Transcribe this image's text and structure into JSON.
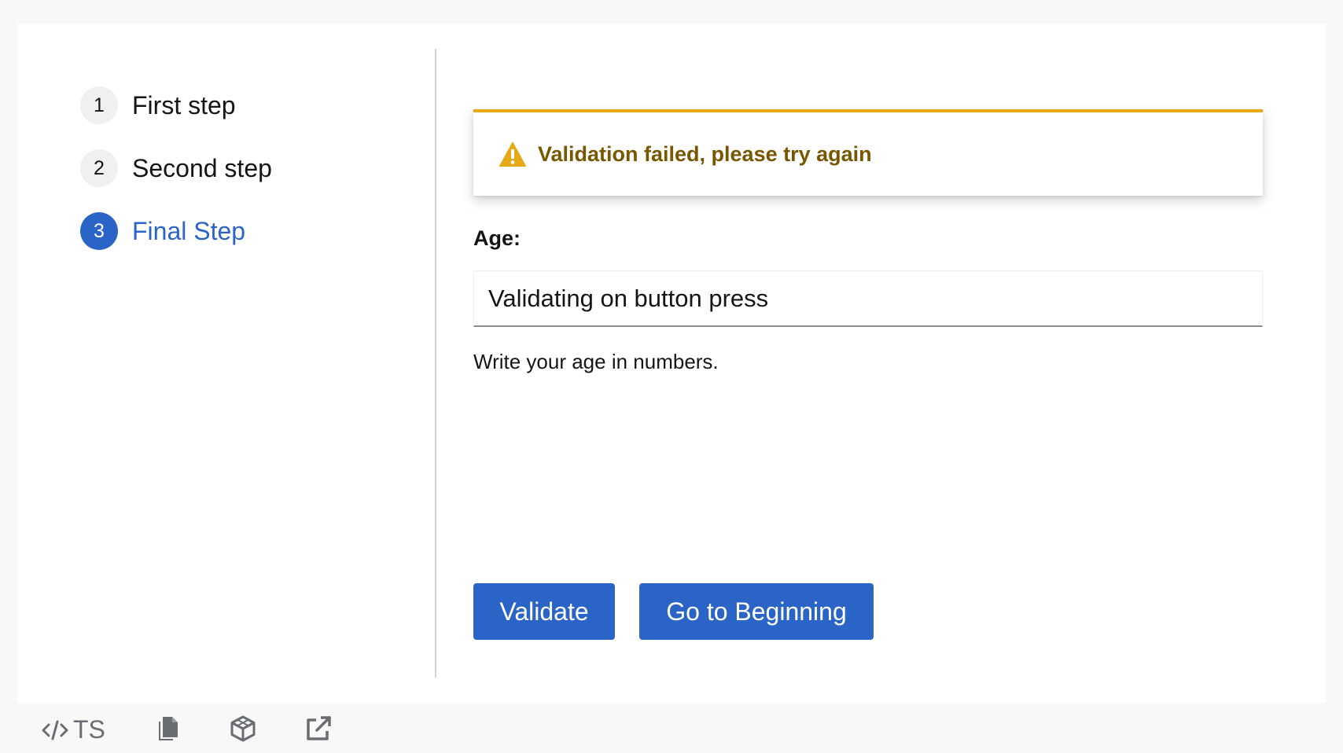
{
  "wizard": {
    "steps": [
      {
        "number": "1",
        "label": "First step",
        "current": false
      },
      {
        "number": "2",
        "label": "Second step",
        "current": false
      },
      {
        "number": "3",
        "label": "Final Step",
        "current": true
      }
    ]
  },
  "alert": {
    "variant": "warning",
    "icon": "warning-triangle-icon",
    "title": "Validation failed, please try again"
  },
  "form": {
    "age_label": "Age:",
    "age_value": "Validating on button press",
    "helper_text": "Write your age in numbers."
  },
  "footer": {
    "validate_label": "Validate",
    "go_to_beginning_label": "Go to Beginning"
  },
  "toolbar": {
    "ts_label": "TS",
    "icons": [
      "code-icon",
      "copy-icon",
      "codesandbox-icon",
      "external-link-icon"
    ]
  },
  "colors": {
    "primary": "#2b64c7",
    "warning_border": "#e6a817",
    "warning_text": "#795600",
    "step_inactive_bg": "#f0f0f0"
  }
}
